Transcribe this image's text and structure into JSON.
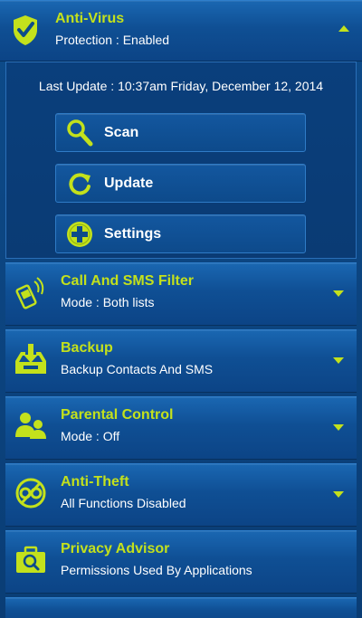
{
  "colors": {
    "accent": "#c3e11c",
    "background": "#0b3f78",
    "text": "#ffffff"
  },
  "antivirus": {
    "icon": "shield-check-icon",
    "title": "Anti-Virus",
    "subtitle": "Protection : Enabled",
    "expanded": true,
    "last_update": "Last Update : 10:37am Friday, December 12, 2014",
    "actions": [
      {
        "label": "Scan",
        "icon": "magnifier-icon"
      },
      {
        "label": "Update",
        "icon": "refresh-icon"
      },
      {
        "label": "Settings",
        "icon": "plus-icon"
      }
    ]
  },
  "sections": [
    {
      "title": "Call And SMS Filter",
      "subtitle": "Mode : Both lists",
      "icon": "phone-filter-icon"
    },
    {
      "title": "Backup",
      "subtitle": "Backup Contacts And SMS",
      "icon": "backup-tray-icon"
    },
    {
      "title": "Parental Control",
      "subtitle": "Mode : Off",
      "icon": "family-icon"
    },
    {
      "title": "Anti-Theft",
      "subtitle": "All Functions Disabled",
      "icon": "anti-theft-icon"
    },
    {
      "title": "Privacy Advisor",
      "subtitle": "Permissions Used By Applications",
      "icon": "briefcase-search-icon"
    }
  ]
}
